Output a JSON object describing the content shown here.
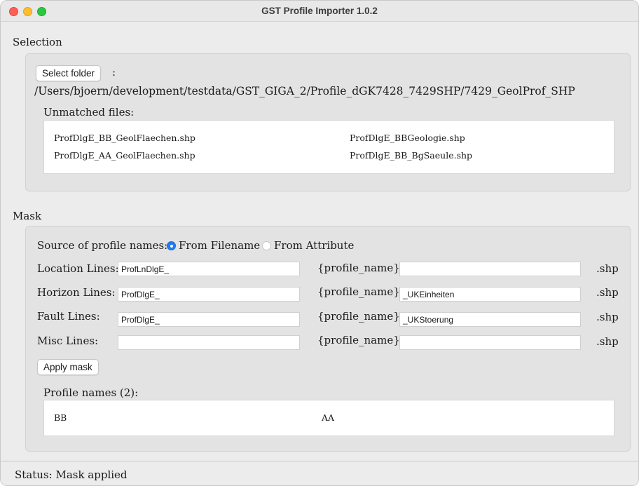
{
  "window": {
    "title": "GST Profile Importer 1.0.2"
  },
  "selection": {
    "label": "Selection",
    "select_folder_button": "Select folder",
    "colon": ":",
    "path": "/Users/bjoern/development/testdata/GST_GIGA_2/Profile_dGK7428_7429SHP/7429_GeolProf_SHP",
    "unmatched_label": "Unmatched files:",
    "unmatched_files": [
      "ProfDlgE_BB_GeolFlaechen.shp",
      "ProfDlgE_BBGeologie.shp",
      "ProfDlgE_AA_GeolFlaechen.shp",
      "ProfDlgE_BB_BgSaeule.shp"
    ]
  },
  "mask": {
    "label": "Mask",
    "source_label": "Source of profile names:",
    "source_options": [
      "From Filename",
      "From Attribute"
    ],
    "source_selected": "From Filename",
    "rows": [
      {
        "label": "Location Lines:",
        "prefix": "ProfLnDlgE_",
        "placeholder": "{profile_name}",
        "suffix": "",
        "ext": ".shp"
      },
      {
        "label": "Horizon Lines:",
        "prefix": "ProfDlgE_",
        "placeholder": "{profile_name}",
        "suffix": "_UKEinheiten",
        "ext": ".shp"
      },
      {
        "label": "Fault Lines:",
        "prefix": "ProfDlgE_",
        "placeholder": "{profile_name}",
        "suffix": "_UKStoerung",
        "ext": ".shp"
      },
      {
        "label": "Misc Lines:",
        "prefix": "",
        "placeholder": "{profile_name}",
        "suffix": "",
        "ext": ".shp"
      }
    ],
    "apply_button": "Apply mask",
    "profile_names_label": "Profile names (2):",
    "profile_names": [
      "BB",
      "AA"
    ]
  },
  "status": {
    "text": "Status: Mask applied"
  }
}
